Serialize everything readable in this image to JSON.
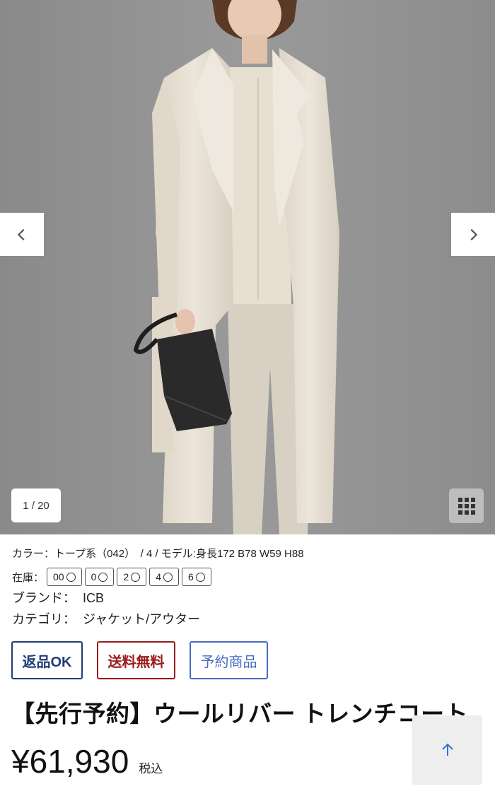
{
  "gallery": {
    "counter": "1 / 20"
  },
  "product": {
    "meta": "カラー：トープ系（042）　/  4  /  モデル:身長172 B78 W59 H88",
    "stock_label": "在庫：",
    "sizes": [
      "00",
      "0",
      "2",
      "4",
      "6"
    ],
    "brand_label": "ブランド：",
    "brand": "ICB",
    "category_label": "カテゴリ：",
    "category": "ジャケット/アウター",
    "badges": {
      "return": "返品OK",
      "shipping": "送料無料",
      "reserve": "予約商品"
    },
    "title": "【先行予約】ウールリバー トレンチコート",
    "price": "¥61,930",
    "tax": "税込"
  },
  "colors": {
    "background": "#8f8f8f",
    "coat": "#e9e1d5",
    "return_badge": "#1f3c78",
    "shipping_badge": "#9b1c1c",
    "reserve_badge": "#4a6bc2",
    "to_top_arrow": "#2f6fd6"
  },
  "icons": {
    "prev": "chevron-left-icon",
    "next": "chevron-right-icon",
    "grid": "grid-icon",
    "to_top": "arrow-up-icon"
  }
}
